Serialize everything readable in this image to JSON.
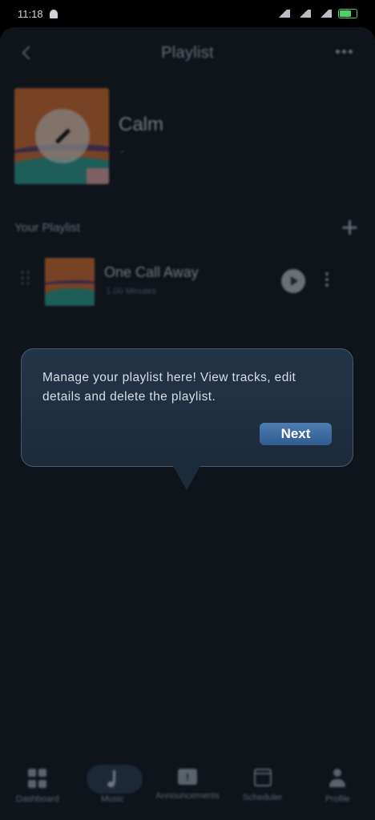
{
  "status_bar": {
    "time": "11:18",
    "icons": [
      "bell-icon",
      "signal-icon",
      "wifi-icon",
      "battery-icon"
    ]
  },
  "header": {
    "title": "Playlist"
  },
  "playlist": {
    "name": "Calm",
    "subtitle": "-"
  },
  "section": {
    "title": "Your Playlist"
  },
  "tracks": [
    {
      "title": "One Call Away",
      "meta": "1.00 Minutes"
    }
  ],
  "tooltip": {
    "text": "Manage your playlist here! View tracks, edit details and delete the playlist.",
    "next_label": "Next"
  },
  "bottom_nav": [
    {
      "label": "Dashboard",
      "icon": "dashboard-icon",
      "active": false
    },
    {
      "label": "Music",
      "icon": "music-note-icon",
      "active": true
    },
    {
      "label": "Announcements",
      "icon": "announcement-icon",
      "active": false
    },
    {
      "label": "Scheduler",
      "icon": "calendar-icon",
      "active": false
    },
    {
      "label": "Profile",
      "icon": "profile-icon",
      "active": false
    }
  ],
  "colors": {
    "background": "#0f141b",
    "tooltip": "#1c2a3a",
    "accent": "#3c6aa1",
    "cover": "#d06a2e"
  }
}
